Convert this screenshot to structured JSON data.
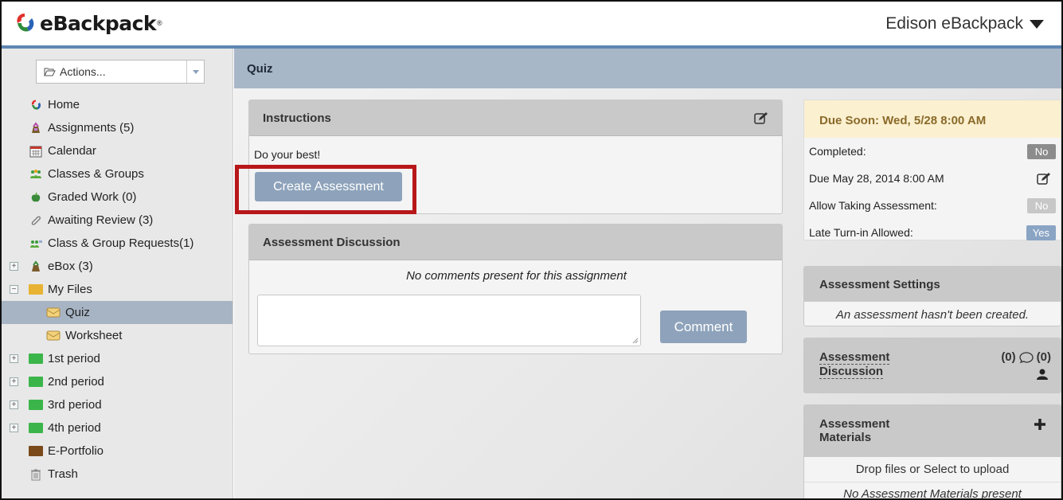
{
  "header": {
    "app_name": "eBackpack",
    "account_name": "Edison eBackpack"
  },
  "sidebar": {
    "actions_label": "Actions...",
    "items": [
      {
        "label": "Home",
        "icon": "home-logo-icon"
      },
      {
        "label": "Assignments (5)",
        "icon": "backpack-icon"
      },
      {
        "label": "Calendar",
        "icon": "calendar-icon"
      },
      {
        "label": "Classes & Groups",
        "icon": "people-icon"
      },
      {
        "label": "Graded Work (0)",
        "icon": "apple-icon"
      },
      {
        "label": "Awaiting Review (3)",
        "icon": "paperclip-icon"
      },
      {
        "label": "Class & Group Requests(1)",
        "icon": "people-request-icon"
      },
      {
        "label": "eBox (3)",
        "icon": "backpack-icon"
      },
      {
        "label": "My Files",
        "icon": "folder-icon"
      },
      {
        "label": "Quiz",
        "icon": "assignment-folder-icon"
      },
      {
        "label": "Worksheet",
        "icon": "assignment-folder-icon"
      },
      {
        "label": "1st period",
        "icon": "folder-icon"
      },
      {
        "label": "2nd period",
        "icon": "folder-icon"
      },
      {
        "label": "3rd period",
        "icon": "folder-icon"
      },
      {
        "label": "4th period",
        "icon": "folder-icon"
      },
      {
        "label": "E-Portfolio",
        "icon": "folder-icon"
      },
      {
        "label": "Trash",
        "icon": "trash-icon"
      }
    ]
  },
  "main": {
    "title": "Quiz",
    "instructions": {
      "heading": "Instructions",
      "text": "Do your best!",
      "create_button": "Create Assessment"
    },
    "discussion": {
      "heading": "Assessment Discussion",
      "empty_text": "No comments present for this assignment",
      "comment_button": "Comment"
    }
  },
  "right": {
    "due_soon": "Due Soon: Wed, 5/28 8:00 AM",
    "completed_label": "Completed:",
    "completed_value": "No",
    "due_date": "Due May 28, 2014 8:00 AM",
    "allow_label": "Allow Taking Assessment:",
    "allow_value": "No",
    "late_label": "Late Turn-in Allowed:",
    "late_value": "Yes",
    "settings_heading": "Assessment Settings",
    "settings_text": "An assessment hasn't been created.",
    "discussion_heading_1": "Assessment",
    "discussion_heading_2": "Discussion",
    "discussion_count_a": "(0)",
    "discussion_count_b": "(0)",
    "materials_heading_1": "Assessment",
    "materials_heading_2": "Materials",
    "materials_drop": "Drop files or Select to upload",
    "materials_empty": "No Assessment Materials present"
  },
  "colors": {
    "accent": "#5f86b3",
    "highlight": "#b8171a",
    "button": "#8ea3bb",
    "pill_gray": "#8c8c8c",
    "pill_blue": "#8aa4c4"
  }
}
